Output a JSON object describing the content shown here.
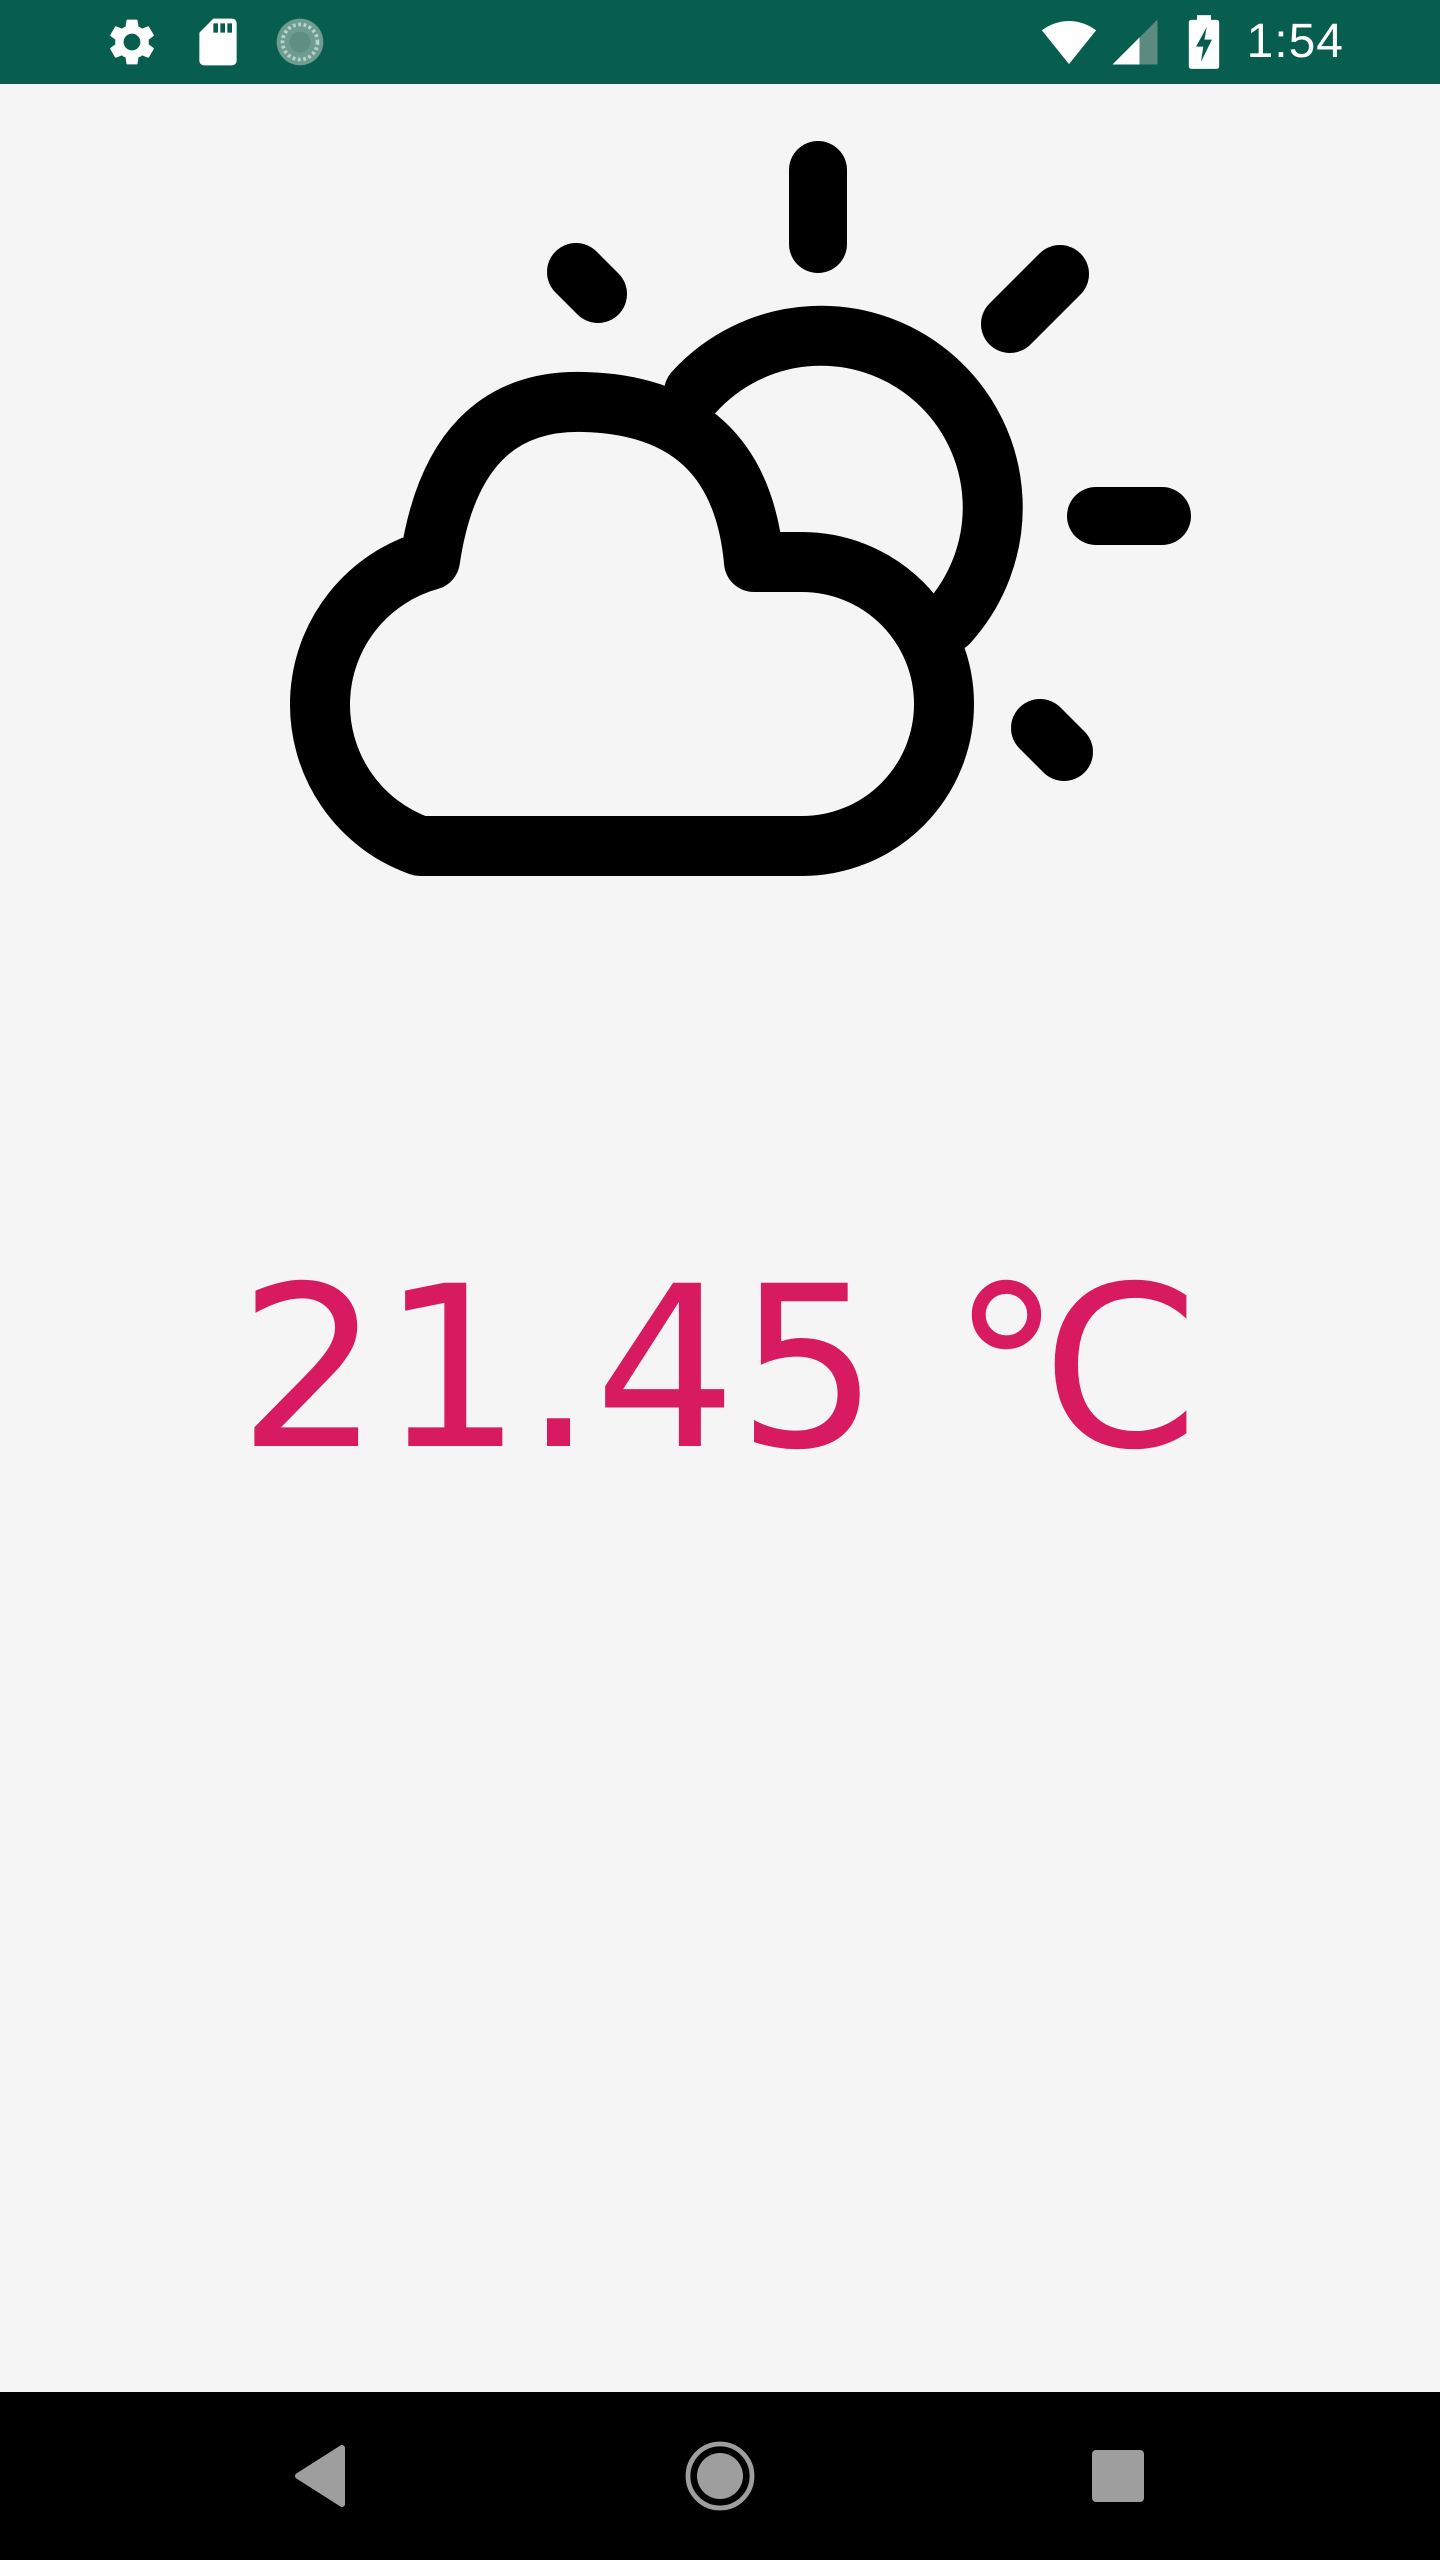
{
  "status_bar": {
    "time": "1:54",
    "left_icons": [
      "gear-icon",
      "sd-card-icon",
      "sync-spinner-icon"
    ],
    "right_icons": [
      "wifi-icon",
      "cellular-signal-icon",
      "battery-charging-icon"
    ],
    "background_color": "#075e4f"
  },
  "weather": {
    "icon": "partly-cloudy-icon",
    "temperature": "21.45 ℃",
    "temperature_color": "#d81b60"
  },
  "nav_bar": {
    "buttons": [
      "back-button",
      "home-button",
      "recents-button"
    ],
    "background_color": "#000000"
  }
}
